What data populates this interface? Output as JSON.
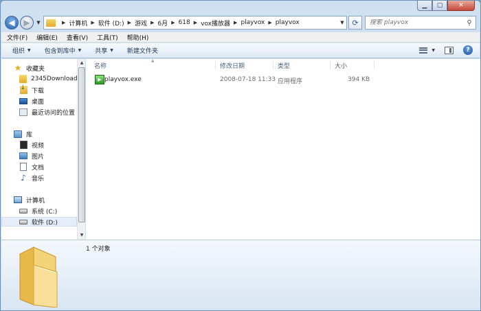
{
  "window": {
    "caption_buttons": [
      "minimize",
      "maximize",
      "close"
    ]
  },
  "address_bar": {
    "crumbs": [
      "计算机",
      "软件 (D:)",
      "游戏",
      "6月",
      "618",
      "vox播放器",
      "playvox",
      "playvox"
    ]
  },
  "search": {
    "placeholder": "搜索 playvox"
  },
  "menu": [
    "文件(F)",
    "编辑(E)",
    "查看(V)",
    "工具(T)",
    "帮助(H)"
  ],
  "toolbar": {
    "organize": "组织",
    "include_in_library": "包含到库中",
    "share": "共享",
    "new_folder": "新建文件夹"
  },
  "nav_pane": {
    "favorites": {
      "label": "收藏夹",
      "items": [
        "2345Downloads",
        "下载",
        "桌面",
        "最近访问的位置"
      ]
    },
    "libraries": {
      "label": "库",
      "items": [
        "视频",
        "图片",
        "文档",
        "音乐"
      ]
    },
    "computer": {
      "label": "计算机",
      "items": [
        "系统 (C:)",
        "软件 (D:)"
      ]
    }
  },
  "columns": [
    "名称",
    "修改日期",
    "类型",
    "大小"
  ],
  "files": [
    {
      "name": "playvox.exe",
      "modified": "2008-07-18 11:33",
      "type": "应用程序",
      "size": "394 KB",
      "icon": "playvox-exe-icon"
    }
  ],
  "details_pane": {
    "count": "1 个对象"
  },
  "colors": {
    "window_frame": "#cfe0f1",
    "toolbar_text": "#1e395b",
    "selection": "#e5eef8",
    "exe_icon": "#2b9a26"
  }
}
